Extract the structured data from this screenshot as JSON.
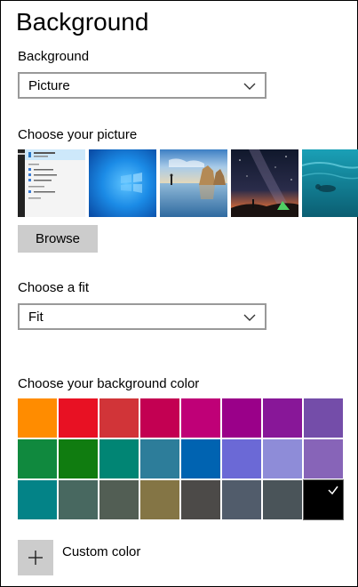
{
  "page": {
    "title": "Background"
  },
  "background": {
    "label": "Background",
    "selected": "Picture"
  },
  "picture": {
    "label": "Choose your picture",
    "thumbnails": [
      {
        "name": "screenshot-start-menu"
      },
      {
        "name": "windows-blue"
      },
      {
        "name": "beach-rocks"
      },
      {
        "name": "night-sky-tent"
      },
      {
        "name": "underwater-swimmer"
      }
    ],
    "browse_label": "Browse"
  },
  "fit": {
    "label": "Choose a fit",
    "selected": "Fit"
  },
  "color": {
    "label": "Choose your background color",
    "swatches": [
      "#ff8c00",
      "#e81123",
      "#d13438",
      "#c30052",
      "#bf0077",
      "#9a0089",
      "#881798",
      "#744da9",
      "#10893e",
      "#107c10",
      "#018574",
      "#2d7d9a",
      "#0063b1",
      "#6b69d6",
      "#8e8cd8",
      "#8764b8",
      "#038387",
      "#486860",
      "#525e54",
      "#847545",
      "#4c4a48",
      "#515c6b",
      "#4a5459",
      "#000000"
    ],
    "selected_index": 23,
    "custom_label": "Custom color"
  }
}
